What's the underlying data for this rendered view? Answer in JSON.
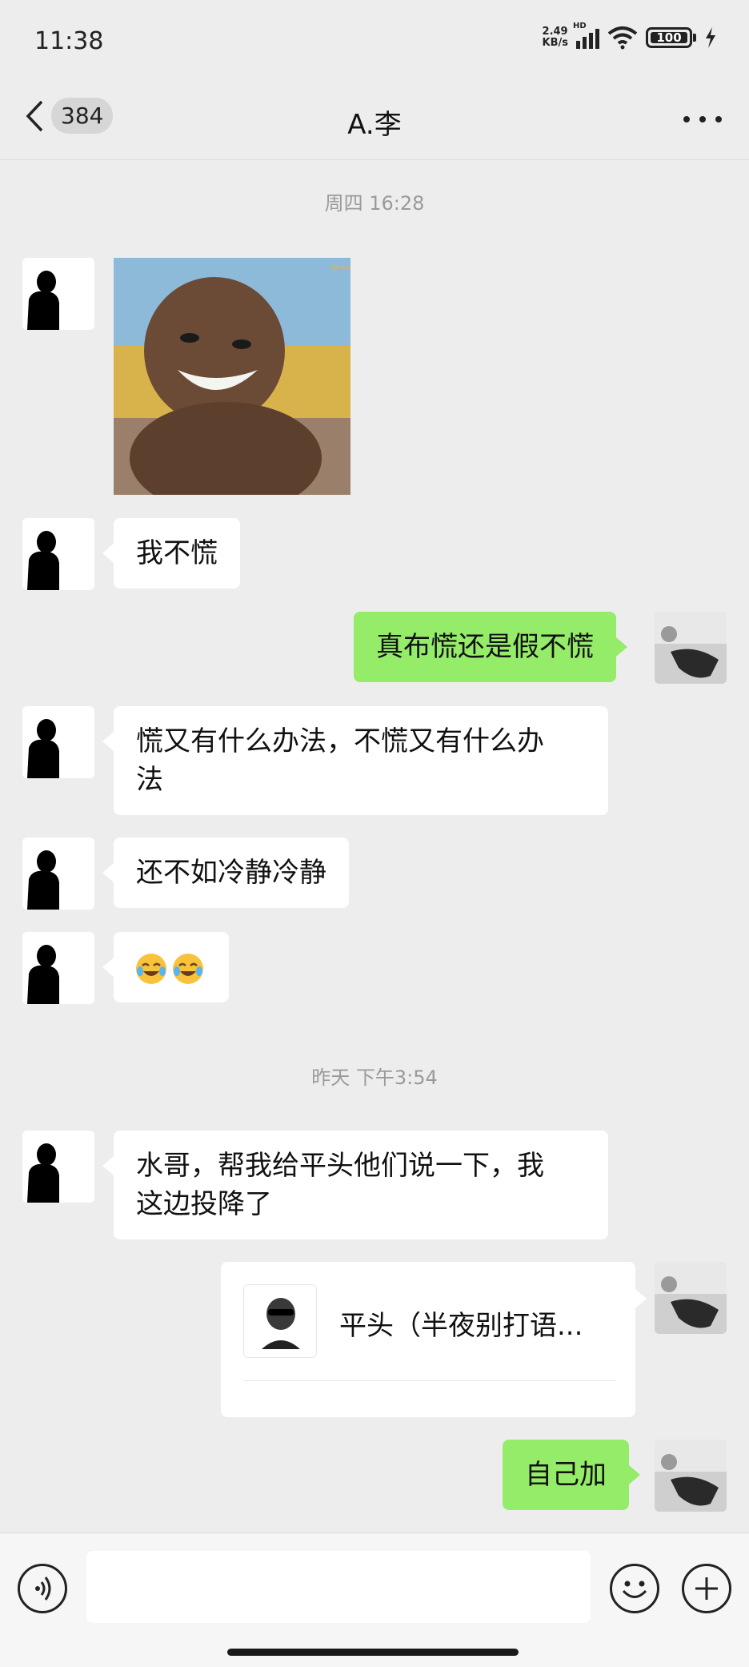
{
  "status": {
    "time": "11:38",
    "net_speed_value": "2.49",
    "net_speed_unit": "KB/s",
    "signal_type": "HD",
    "battery": "100",
    "wifi_icon": "wifi-icon",
    "charging_icon": "lightning-icon"
  },
  "header": {
    "back_icon": "chevron-left-icon",
    "unread_count": "384",
    "title": "A.李",
    "more_icon": "more-dots-icon"
  },
  "messages": [
    {
      "type": "timestamp",
      "text": "周四 16:28"
    },
    {
      "type": "image",
      "sender": "other"
    },
    {
      "type": "text",
      "sender": "other",
      "text": "我不慌"
    },
    {
      "type": "text",
      "sender": "me",
      "text": "真布慌还是假不慌"
    },
    {
      "type": "text",
      "sender": "other",
      "line1": "慌又有什么办法，不慌又有什么办",
      "line2": "法"
    },
    {
      "type": "text",
      "sender": "other",
      "text": "还不如冷静冷静"
    },
    {
      "type": "emoji",
      "sender": "other",
      "emoji": "crying-laughing-emoji"
    },
    {
      "type": "timestamp",
      "text": "昨天 下午3:54"
    },
    {
      "type": "text",
      "sender": "other",
      "line1": "水哥，帮我给平头他们说一下，我",
      "line2": "这边投降了"
    },
    {
      "type": "contact_card",
      "sender": "me",
      "name": "平头（半夜别打语..."
    },
    {
      "type": "text",
      "sender": "me",
      "text": "自己加"
    }
  ],
  "input_bar": {
    "voice_icon": "voice-icon",
    "input_value": "",
    "emoji_icon": "smiley-icon",
    "plus_icon": "plus-icon"
  },
  "colors": {
    "background": "#ededed",
    "bubble_self": "#95ec69",
    "bubble_other": "#ffffff",
    "timestamp": "#9a9a9a"
  }
}
